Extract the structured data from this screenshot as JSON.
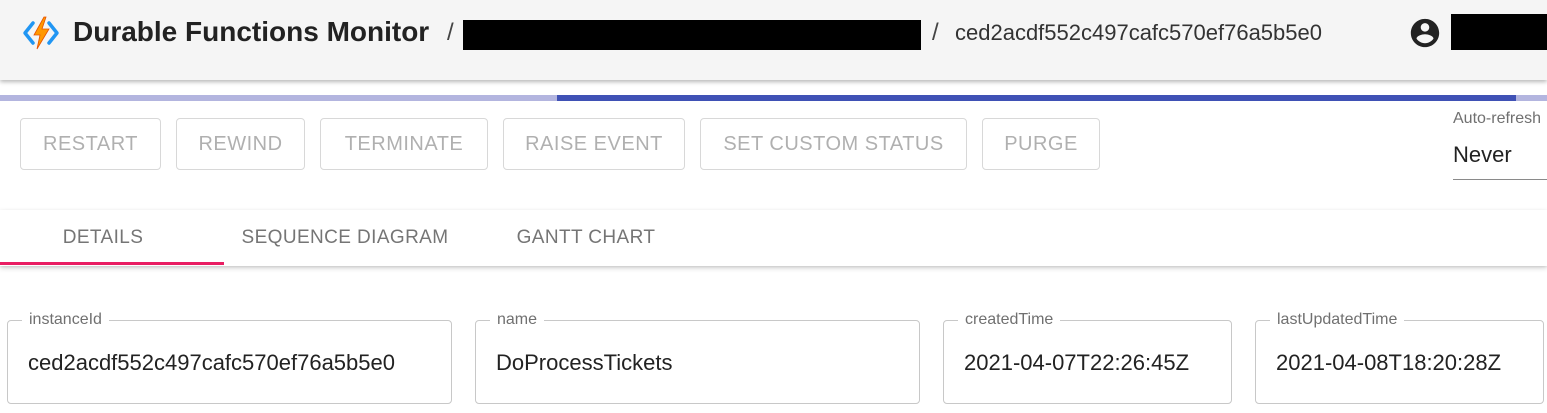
{
  "header": {
    "title": "Durable Functions Monitor",
    "separator": "/",
    "instance_id": "ced2acdf552c497cafc570ef76a5b5e0"
  },
  "progress": {
    "indicator_fraction_start": 0.36,
    "indicator_fraction_end": 0.98
  },
  "toolbar": {
    "buttons": [
      "RESTART",
      "REWIND",
      "TERMINATE",
      "RAISE EVENT",
      "SET CUSTOM STATUS",
      "PURGE"
    ]
  },
  "auto_refresh": {
    "label": "Auto-refresh",
    "value": "Never"
  },
  "tabs": [
    {
      "label": "DETAILS",
      "selected": true
    },
    {
      "label": "SEQUENCE DIAGRAM",
      "selected": false
    },
    {
      "label": "GANTT CHART",
      "selected": false
    }
  ],
  "fields": {
    "instanceId": {
      "label": "instanceId",
      "value": "ced2acdf552c497cafc570ef76a5b5e0"
    },
    "name": {
      "label": "name",
      "value": "DoProcessTickets"
    },
    "createdTime": {
      "label": "createdTime",
      "value": "2021-04-07T22:26:45Z"
    },
    "lastUpdatedTime": {
      "label": "lastUpdatedTime",
      "value": "2021-04-08T18:20:28Z"
    }
  },
  "colors": {
    "primary": "#3f51b5",
    "primary_light": "#b3b5df",
    "tab_indicator": "#e91e63",
    "logo_orange": "#ff9800",
    "logo_blue": "#2196f3"
  }
}
